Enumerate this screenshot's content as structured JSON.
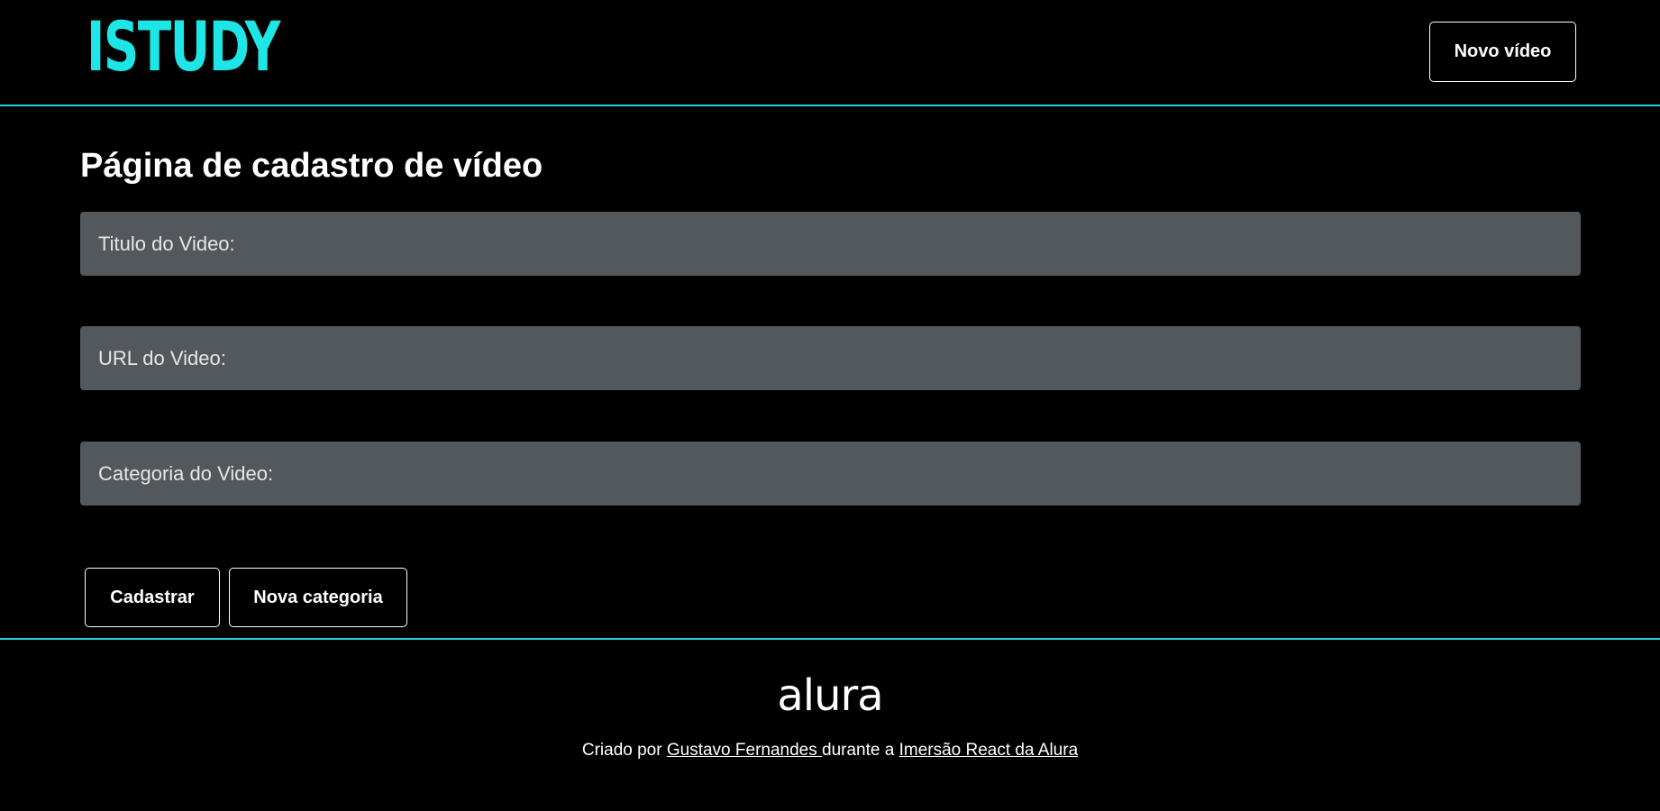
{
  "header": {
    "logo_text": "ISTUDY",
    "new_video_button": "Novo vídeo",
    "accent_color": "#2ad2d6"
  },
  "main": {
    "title": "Página de cadastro de vídeo",
    "fields": [
      {
        "label": "Titulo do Video:"
      },
      {
        "label": "URL do Video:"
      },
      {
        "label": "Categoria do Video:"
      }
    ],
    "buttons": {
      "submit": "Cadastrar",
      "new_category": "Nova categoria"
    }
  },
  "footer": {
    "logo_text": "alura",
    "prefix": "Criado por ",
    "author_link": "Gustavo Fernandes ",
    "middle": "durante a ",
    "event_link": "Imersão React da Alura"
  }
}
